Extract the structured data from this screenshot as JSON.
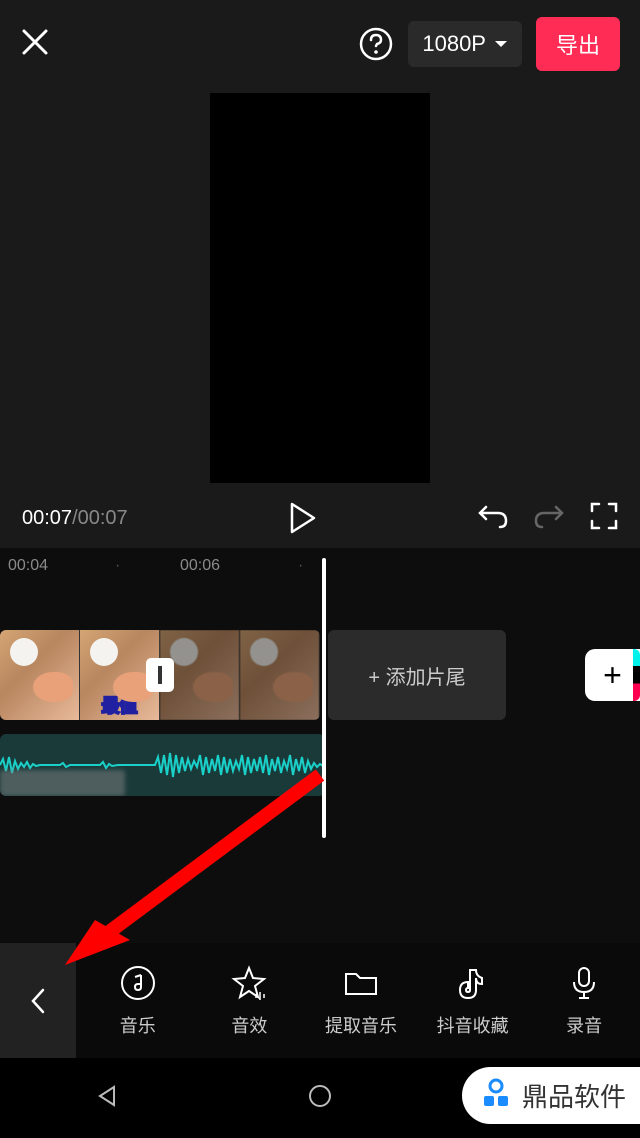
{
  "header": {
    "resolution": "1080P",
    "export": "导出"
  },
  "playback": {
    "current_time": "00:07",
    "total_time": "00:07"
  },
  "ruler": {
    "t1": "00:04",
    "t2": "00:06"
  },
  "timeline": {
    "add_ending": "+  添加片尾",
    "add_clip": "+",
    "thumb_caption": "最值"
  },
  "toolbar": {
    "music": "音乐",
    "sfx": "音效",
    "extract": "提取音乐",
    "douyin_fav": "抖音收藏",
    "record": "录音"
  },
  "watermark": {
    "text": "鼎品软件"
  }
}
